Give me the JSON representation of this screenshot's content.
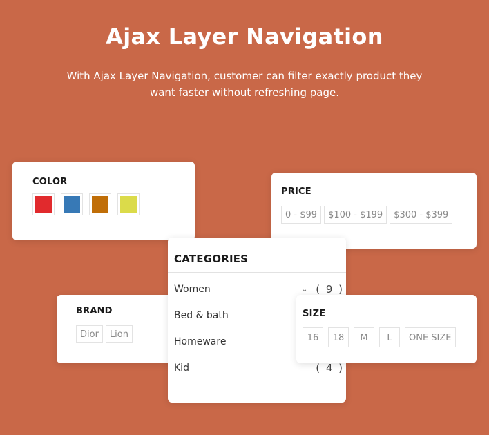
{
  "header": {
    "title": "Ajax Layer Navigation",
    "subtitle": "With Ajax Layer Navigation, customer can filter exactly product they want faster without refreshing page."
  },
  "color_filter": {
    "title": "COLOR",
    "swatches": [
      {
        "name": "red",
        "hex": "#e12a2d"
      },
      {
        "name": "blue",
        "hex": "#3779b6"
      },
      {
        "name": "orange",
        "hex": "#c06e08"
      },
      {
        "name": "yellow",
        "hex": "#dbdb4a"
      }
    ]
  },
  "price_filter": {
    "title": "PRICE",
    "options": [
      "0 - $99",
      "$100 - $199",
      "$300 - $399"
    ]
  },
  "categories": {
    "title": "CATEGORIES",
    "items": [
      {
        "label": "Women",
        "count": "( 9 )",
        "expandable": true
      },
      {
        "label": "Bed & bath",
        "count": "",
        "expandable": false
      },
      {
        "label": "Homeware",
        "count": "",
        "expandable": false
      },
      {
        "label": "Kid",
        "count": "( 4 )",
        "expandable": false
      }
    ]
  },
  "brand_filter": {
    "title": "BRAND",
    "options": [
      "Dior",
      "Lion"
    ]
  },
  "size_filter": {
    "title": "SIZE",
    "options": [
      "16",
      "18",
      "M",
      "L",
      "ONE SIZE"
    ]
  }
}
